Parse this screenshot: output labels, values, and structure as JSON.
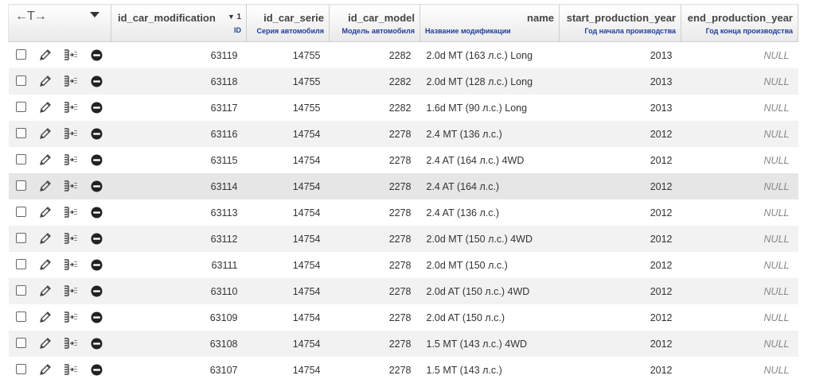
{
  "toolbar": {
    "arrows_glyph": "←T→"
  },
  "columns": [
    {
      "name": "id_car_modification",
      "sort_arrow": "▼",
      "sort_order": "1",
      "desc": "ID"
    },
    {
      "name": "id_car_serie",
      "desc": "Серия автомобиля"
    },
    {
      "name": "id_car_model",
      "desc": "Модель автомобиля"
    },
    {
      "name": "name",
      "desc": "Название модификации"
    },
    {
      "name": "start_production_year",
      "desc": "Год начала производства"
    },
    {
      "name": "end_production_year",
      "desc": "Год конца производства"
    }
  ],
  "rows": [
    {
      "id": "63119",
      "serie": "14755",
      "model": "2282",
      "name": "2.0d MT (163 л.с.) Long",
      "start": "2013",
      "end": "NULL"
    },
    {
      "id": "63118",
      "serie": "14755",
      "model": "2282",
      "name": "2.0d MT (128 л.с.) Long",
      "start": "2013",
      "end": "NULL"
    },
    {
      "id": "63117",
      "serie": "14755",
      "model": "2282",
      "name": "1.6d MT (90 л.с.) Long",
      "start": "2013",
      "end": "NULL"
    },
    {
      "id": "63116",
      "serie": "14754",
      "model": "2278",
      "name": "2.4 MT (136 л.с.)",
      "start": "2012",
      "end": "NULL"
    },
    {
      "id": "63115",
      "serie": "14754",
      "model": "2278",
      "name": "2.4 AT (164 л.с.) 4WD",
      "start": "2012",
      "end": "NULL"
    },
    {
      "id": "63114",
      "serie": "14754",
      "model": "2278",
      "name": "2.4 AT (164 л.с.)",
      "start": "2012",
      "end": "NULL"
    },
    {
      "id": "63113",
      "serie": "14754",
      "model": "2278",
      "name": "2.4 AT (136 л.с.)",
      "start": "2012",
      "end": "NULL"
    },
    {
      "id": "63112",
      "serie": "14754",
      "model": "2278",
      "name": "2.0d MT (150 л.с.) 4WD",
      "start": "2012",
      "end": "NULL"
    },
    {
      "id": "63111",
      "serie": "14754",
      "model": "2278",
      "name": "2.0d MT (150 л.с.)",
      "start": "2012",
      "end": "NULL"
    },
    {
      "id": "63110",
      "serie": "14754",
      "model": "2278",
      "name": "2.0d AT (150 л.с.) 4WD",
      "start": "2012",
      "end": "NULL"
    },
    {
      "id": "63109",
      "serie": "14754",
      "model": "2278",
      "name": "2.0d AT (150 л.с.)",
      "start": "2012",
      "end": "NULL"
    },
    {
      "id": "63108",
      "serie": "14754",
      "model": "2278",
      "name": "1.5 MT (143 л.с.) 4WD",
      "start": "2012",
      "end": "NULL"
    },
    {
      "id": "63107",
      "serie": "14754",
      "model": "2278",
      "name": "1.5 MT (143 л.с.)",
      "start": "2012",
      "end": "NULL"
    }
  ],
  "row_icons": {
    "edit": "pencil-icon",
    "copy": "copy-insert-icon",
    "delete": "delete-icon"
  },
  "colors": {
    "header_desc": "#1f3c99",
    "row_alt": "#f2f2f2",
    "row_hover": "#e6e6e6",
    "null_text": "#888888"
  }
}
